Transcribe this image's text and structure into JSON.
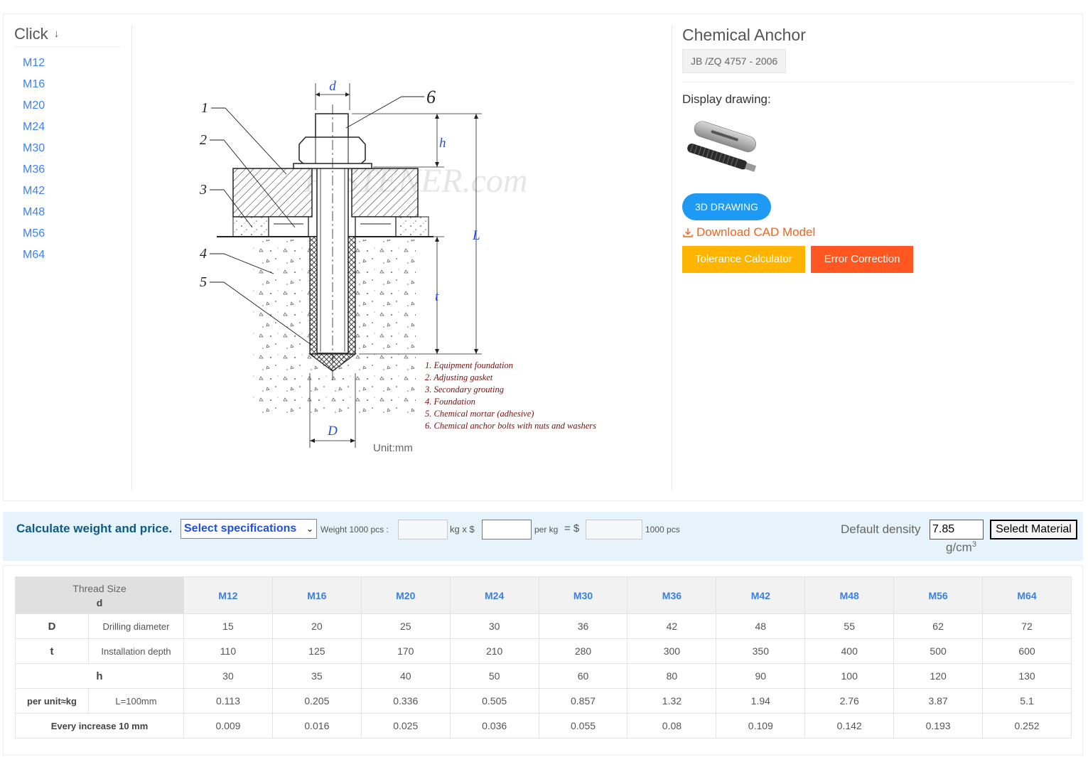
{
  "sidebar": {
    "title": "Click",
    "items": [
      "M12",
      "M16",
      "M20",
      "M24",
      "M30",
      "M36",
      "M42",
      "M48",
      "M56",
      "M64"
    ]
  },
  "drawing": {
    "dim_labels": {
      "d": "d",
      "h": "h",
      "L": "L",
      "t": "t",
      "D": "D"
    },
    "callout_numbers": [
      "1",
      "2",
      "3",
      "4",
      "5",
      "6"
    ],
    "legend": [
      "1. Equipment foundation",
      "2. Adjusting gasket",
      "3. Secondary grouting",
      "4. Foundation",
      "5. Chemical mortar (adhesive)",
      "6. Chemical anchor bolts with nuts and washers"
    ],
    "watermark": "FASTENER.com",
    "unit": "Unit:mm"
  },
  "product": {
    "title": "Chemical Anchor",
    "standard": "JB /ZQ 4757 - 2006",
    "display_label": "Display drawing:",
    "btn_3d": "3D DRAWING",
    "cad_link": "Download CAD Model",
    "btn_tolerance": "Tolerance Calculator",
    "btn_error": "Error Correction"
  },
  "calc": {
    "title": "Calculate weight and price.",
    "select_value": "Select specifications",
    "weight_label": "Weight 1000 pcs :",
    "kg_x": "kg x $",
    "per_kg": "per kg",
    "equals": "= $",
    "pcs_label": "1000 pcs",
    "density_label": "Default density",
    "density_value": "7.85",
    "density_unit": "g/cm",
    "density_exp": "3",
    "material_btn": "Seledt Material"
  },
  "table": {
    "head_label_1": "Thread Size",
    "head_label_2": "d",
    "sizes": [
      "M12",
      "M16",
      "M20",
      "M24",
      "M30",
      "M36",
      "M42",
      "M48",
      "M56",
      "M64"
    ],
    "rows": [
      {
        "sym": "D",
        "desc": "Drilling diameter",
        "values": [
          "15",
          "20",
          "25",
          "30",
          "36",
          "42",
          "48",
          "55",
          "62",
          "72"
        ]
      },
      {
        "sym": "t",
        "desc": "Installation depth",
        "values": [
          "110",
          "125",
          "170",
          "210",
          "280",
          "300",
          "350",
          "400",
          "500",
          "600"
        ]
      },
      {
        "sym": "h",
        "desc": "",
        "values": [
          "30",
          "35",
          "40",
          "50",
          "60",
          "80",
          "90",
          "100",
          "120",
          "130"
        ]
      },
      {
        "sym": "per unit≈kg",
        "desc": "L=100mm",
        "values": [
          "0.113",
          "0.205",
          "0.336",
          "0.505",
          "0.857",
          "1.32",
          "1.94",
          "2.76",
          "3.87",
          "5.1"
        ]
      },
      {
        "sym": "Every increase 10 mm",
        "desc": "",
        "values": [
          "0.009",
          "0.016",
          "0.025",
          "0.036",
          "0.055",
          "0.08",
          "0.109",
          "0.142",
          "0.193",
          "0.252"
        ]
      }
    ]
  },
  "colors": {
    "link_blue": "#3b82f6",
    "btn_blue": "#1e9af5",
    "orange": "#f0641e",
    "amber": "#ffb400",
    "red_orange": "#ff5722",
    "calc_bg": "#e6f3fa",
    "calc_title": "#0e5a84",
    "drawing_blue": "#2a4fd0",
    "legend_red": "#7a0f0f"
  }
}
